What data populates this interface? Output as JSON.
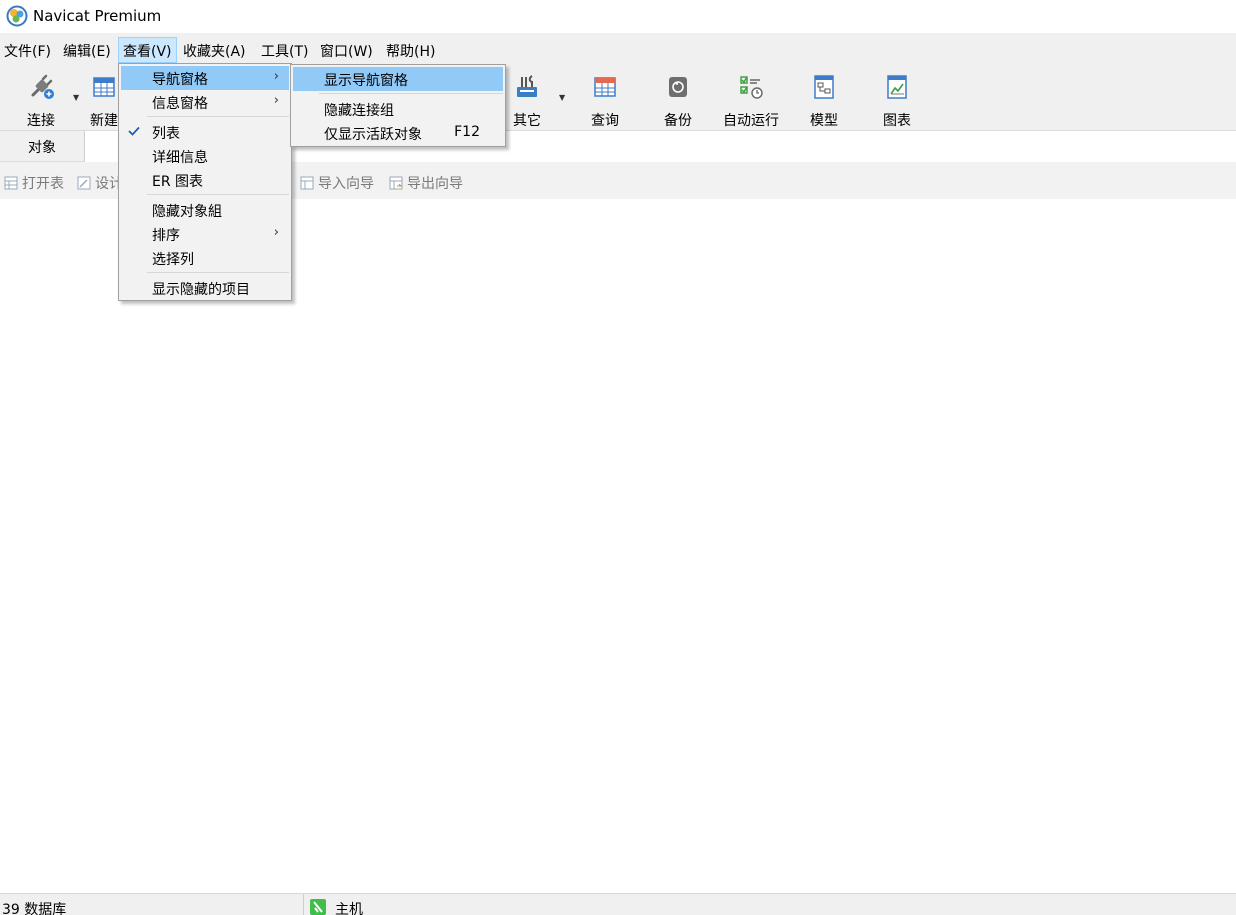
{
  "window": {
    "title": "Navicat Premium"
  },
  "menubar": [
    {
      "label": "文件(F)"
    },
    {
      "label": "编辑(E)"
    },
    {
      "label": "查看(V)"
    },
    {
      "label": "收藏夹(A)"
    },
    {
      "label": "工具(T)"
    },
    {
      "label": "窗口(W)"
    },
    {
      "label": "帮助(H)"
    }
  ],
  "toolbar": [
    {
      "label": "连接",
      "icon": "plug-icon"
    },
    {
      "label": "新建",
      "icon": "table-new-icon"
    },
    {
      "label": "其它",
      "icon": "tools-icon"
    },
    {
      "label": "查询",
      "icon": "query-table-icon"
    },
    {
      "label": "备份",
      "icon": "backup-disk-icon"
    },
    {
      "label": "自动运行",
      "icon": "schedule-checklist-icon"
    },
    {
      "label": "模型",
      "icon": "model-diagram-icon"
    },
    {
      "label": "图表",
      "icon": "chart-icon"
    }
  ],
  "objects_tab": {
    "label": "对象"
  },
  "actions": [
    {
      "label": "打开表"
    },
    {
      "label": "设计"
    },
    {
      "label": "导入向导"
    },
    {
      "label": "导出向导"
    }
  ],
  "view_menu": {
    "items": [
      {
        "label": "导航窗格",
        "submenu": true,
        "highlighted": true
      },
      {
        "label": "信息窗格",
        "submenu": true
      },
      {
        "label": "列表",
        "checked": true
      },
      {
        "label": "详细信息"
      },
      {
        "label": "ER 图表"
      },
      {
        "label": "隐藏对象組"
      },
      {
        "label": "排序",
        "submenu": true
      },
      {
        "label": "选择列"
      },
      {
        "label": "显示隐藏的项目"
      }
    ]
  },
  "nav_submenu": {
    "items": [
      {
        "label": "显示导航窗格",
        "highlighted": true
      },
      {
        "label": "隐藏连接组"
      },
      {
        "label": "仅显示活跃对象",
        "shortcut": "F12"
      }
    ]
  },
  "statusbar": {
    "left": "39 数据库",
    "host": "主机"
  },
  "colors": {
    "menu_highlight": "#91c9f7",
    "menubar_active": "#cce8ff",
    "chrome_bg": "#f0f0f0"
  }
}
